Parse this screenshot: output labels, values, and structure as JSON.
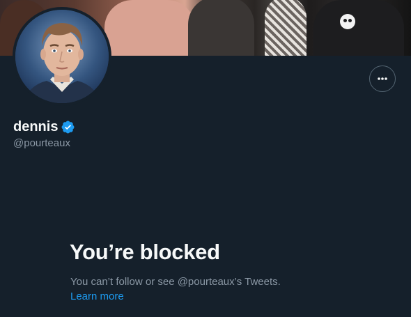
{
  "profile": {
    "display_name": "dennis",
    "handle": "@pourteaux",
    "verified": true,
    "verified_icon": "verified-badge-icon",
    "more_icon": "more-horizontal-icon"
  },
  "blocked": {
    "title": "You’re blocked",
    "description": "You can’t follow or see @pourteaux’s Tweets.",
    "learn_more": "Learn more"
  },
  "colors": {
    "background": "#15202b",
    "primary_text": "#f7f9f9",
    "secondary_text": "#8b98a5",
    "accent": "#1d9bf0",
    "border": "#536471"
  }
}
